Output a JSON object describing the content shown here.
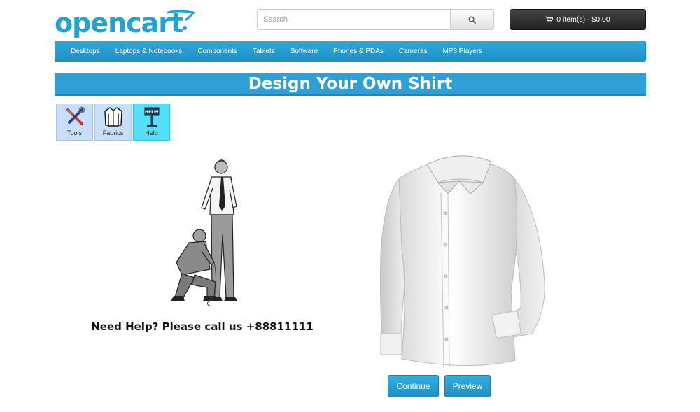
{
  "header": {
    "logo_text": "opencart",
    "search": {
      "placeholder": "Search",
      "value": "",
      "button_icon": "search-icon"
    },
    "cart": {
      "icon": "shopping-cart-icon",
      "label": "0 item(s) - $0.00"
    }
  },
  "menu": {
    "items": [
      {
        "label": "Desktops"
      },
      {
        "label": "Laptops & Notebooks"
      },
      {
        "label": "Components"
      },
      {
        "label": "Tablets"
      },
      {
        "label": "Software"
      },
      {
        "label": "Phones & PDAs"
      },
      {
        "label": "Cameras"
      },
      {
        "label": "MP3 Players"
      }
    ]
  },
  "page": {
    "title": "Design Your Own Shirt"
  },
  "tools": {
    "items": [
      {
        "label": "Tools",
        "icon": "screwdriver-wrench-icon",
        "active": false
      },
      {
        "label": "Fabrics",
        "icon": "shirt-icon",
        "active": false
      },
      {
        "label": "Help",
        "icon": "help-sign-icon",
        "active": true,
        "sign_text": "HELP!"
      }
    ]
  },
  "help": {
    "text": "Need Help? Please call us +88811111"
  },
  "actions": {
    "continue_label": "Continue",
    "preview_label": "Preview"
  },
  "colors": {
    "brand": "#23a1d1",
    "menu_blue": "#2fa0d5",
    "active_tab": "#55dff9",
    "inactive_tab": "#c8dff9",
    "cart_button": "#333333"
  }
}
